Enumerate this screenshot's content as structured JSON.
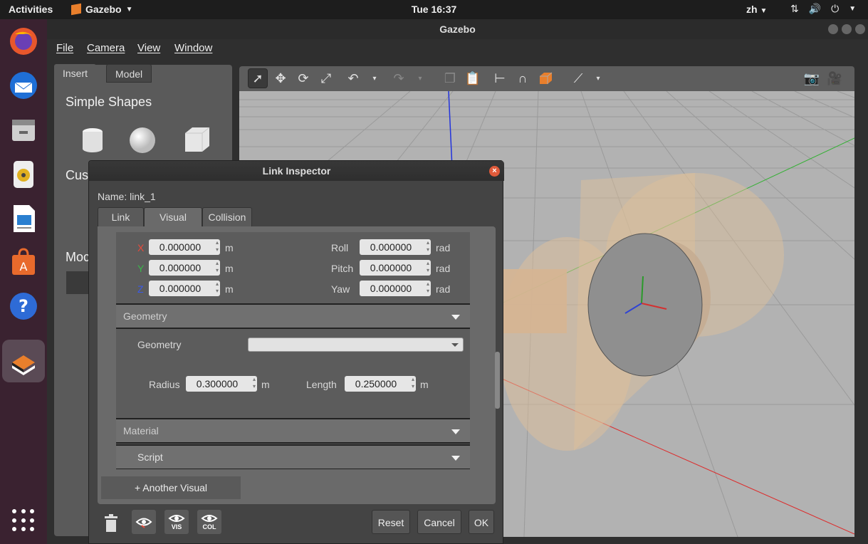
{
  "topbar": {
    "activities": "Activities",
    "app": "Gazebo",
    "clock": "Tue 16:37",
    "lang": "zh"
  },
  "window": {
    "title": "Gazebo"
  },
  "menu": {
    "file": "File",
    "camera": "Camera",
    "view": "View",
    "window": "Window"
  },
  "left_panel": {
    "tabs": [
      "Insert",
      "Model"
    ],
    "simple_shapes": "Simple Shapes",
    "custom_partial": "Cust",
    "model_partial": "Moc"
  },
  "dialog": {
    "title": "Link Inspector",
    "close": "×",
    "name_label": "Name:",
    "name_value": "link_1",
    "tabs": [
      "Link",
      "Visual",
      "Collision"
    ],
    "pose": {
      "x": {
        "label": "X",
        "value": "0.000000",
        "unit": "m"
      },
      "y": {
        "label": "Y",
        "value": "0.000000",
        "unit": "m"
      },
      "z": {
        "label": "Z",
        "value": "0.000000",
        "unit": "m"
      },
      "roll": {
        "label": "Roll",
        "value": "0.000000",
        "unit": "rad"
      },
      "pitch": {
        "label": "Pitch",
        "value": "0.000000",
        "unit": "rad"
      },
      "yaw": {
        "label": "Yaw",
        "value": "0.000000",
        "unit": "rad"
      }
    },
    "geometry_section": "Geometry",
    "geometry_label": "Geometry",
    "geometry_type": "",
    "radius": {
      "label": "Radius",
      "value": "0.300000",
      "unit": "m"
    },
    "length": {
      "label": "Length",
      "value": "0.250000",
      "unit": "m"
    },
    "material_section": "Material",
    "script_label": "Script",
    "another_visual": "+ Another Visual",
    "vis_label": "VIS",
    "col_label": "COL",
    "reset": "Reset",
    "cancel": "Cancel",
    "ok": "OK"
  },
  "colors": {
    "x_axis": "#e84a3a",
    "y_axis": "#3ab54a",
    "z_axis": "#3a5ae8",
    "accent": "#e97f2c",
    "cylinder": "#e0c09a"
  }
}
